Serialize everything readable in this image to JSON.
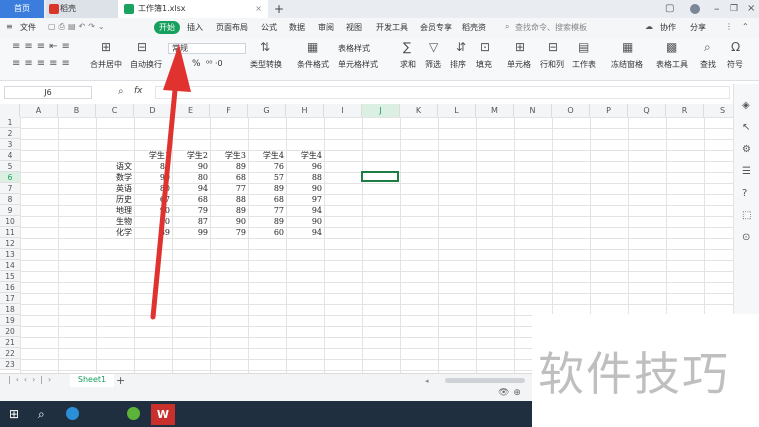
{
  "tabs": {
    "home": "首页",
    "daoke": "稻壳",
    "doc": "工作簿1.xlsx",
    "new": "+"
  },
  "titlebar_right": {
    "collab": "协作",
    "share": "分享"
  },
  "menu": {
    "file": "文件",
    "items": [
      "开始",
      "插入",
      "页面布局",
      "公式",
      "数据",
      "审阅",
      "视图",
      "开发工具",
      "会员专享",
      "稻壳资"
    ],
    "search_placeholder": "查找命令、搜索模板"
  },
  "toolbar": {
    "merge": "合并居中",
    "wrap": "自动换行",
    "format_value": "常规",
    "percent": "%",
    "decimals": "⁰⁰ ·0",
    "convert": "类型转换",
    "cond_format": "条件格式",
    "table_style": "表格样式",
    "cell_style": "单元格样式",
    "sum": "求和",
    "filter": "筛选",
    "sort": "排序",
    "fill": "填充",
    "cell": "单元格",
    "rowcol": "行和列",
    "sheet": "工作表",
    "freeze": "冻结窗格",
    "table_tools": "表格工具",
    "find": "查找",
    "symbol": "符号"
  },
  "formula": {
    "name_box": "J6",
    "fx": "fx"
  },
  "columns": [
    "A",
    "B",
    "C",
    "D",
    "E",
    "F",
    "G",
    "H",
    "I",
    "J",
    "K",
    "L",
    "M",
    "N",
    "O",
    "P",
    "Q",
    "R",
    "S"
  ],
  "rows": [
    "1",
    "2",
    "3",
    "4",
    "5",
    "6",
    "7",
    "8",
    "9",
    "10",
    "11",
    "12",
    "13",
    "14",
    "15",
    "16",
    "17",
    "18",
    "19",
    "20",
    "21",
    "22",
    "23"
  ],
  "table": {
    "headers": [
      "学生1",
      "学生2",
      "学生3",
      "学生4",
      "学生4"
    ],
    "subjects": [
      "语文",
      "数学",
      "英语",
      "历史",
      "地理",
      "生物",
      "化学"
    ],
    "values": [
      [
        89,
        90,
        89,
        76,
        96
      ],
      [
        90,
        80,
        68,
        57,
        88
      ],
      [
        80,
        94,
        77,
        89,
        90
      ],
      [
        67,
        68,
        88,
        68,
        97
      ],
      [
        90,
        79,
        89,
        77,
        94
      ],
      [
        80,
        87,
        90,
        89,
        90
      ],
      [
        89,
        99,
        79,
        60,
        94
      ]
    ]
  },
  "sheet_tab": "Sheet1",
  "watermark": "软件技巧",
  "colors": {
    "accent": "#17a05d",
    "arrow": "#e0322f",
    "tab_blue": "#3b7ddd",
    "taskbar": "#1f2f40"
  }
}
